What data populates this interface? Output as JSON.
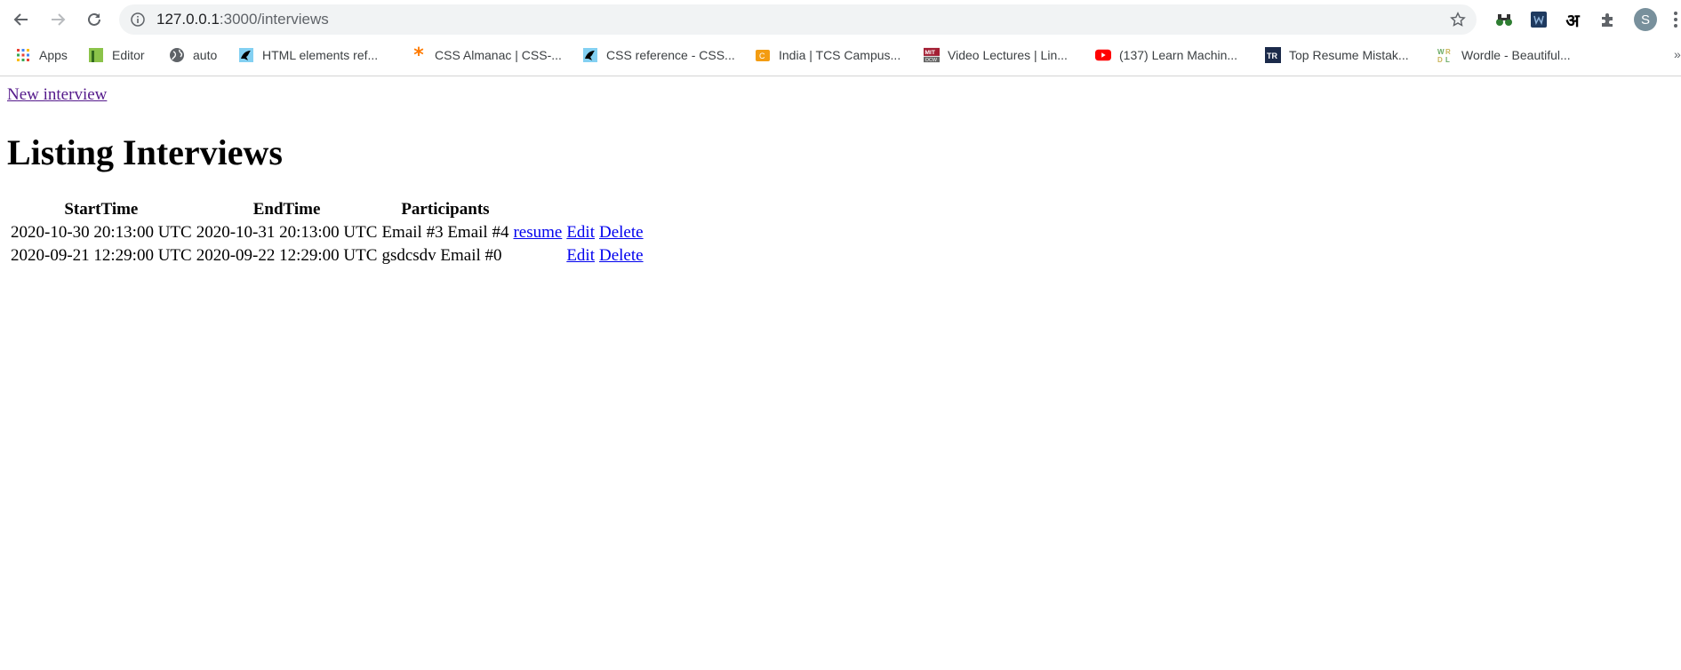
{
  "browser": {
    "url_host": "127.0.0.1",
    "url_path": ":3000/interviews",
    "avatar_letter": "S",
    "devanagari_ext": "अ",
    "bookmarks": [
      {
        "label": "Apps",
        "icon": "apps-grid-icon"
      },
      {
        "label": "Editor",
        "icon": "editor-icon"
      },
      {
        "label": "auto",
        "icon": "globe-icon"
      },
      {
        "label": "HTML elements ref...",
        "icon": "mdn-icon"
      },
      {
        "label": "CSS Almanac | CSS-...",
        "icon": "css-tricks-icon"
      },
      {
        "label": "CSS reference - CSS...",
        "icon": "mdn-icon"
      },
      {
        "label": "India | TCS Campus...",
        "icon": "tcs-icon"
      },
      {
        "label": "Video Lectures | Lin...",
        "icon": "mit-ocw-icon"
      },
      {
        "label": "(137) Learn Machin...",
        "icon": "youtube-icon"
      },
      {
        "label": "Top Resume Mistak...",
        "icon": "topresume-icon"
      },
      {
        "label": "Wordle - Beautiful...",
        "icon": "wordle-icon"
      }
    ],
    "more_label": "»"
  },
  "page": {
    "new_link": "New interview",
    "title": "Listing Interviews",
    "columns": [
      "StartTime",
      "EndTime",
      "Participants"
    ],
    "rows": [
      {
        "start": "2020-10-30 20:13:00 UTC",
        "end": "2020-10-31 20:13:00 UTC",
        "participants": "Email #3 Email #4",
        "resume": "resume",
        "edit": "Edit",
        "delete": "Delete"
      },
      {
        "start": "2020-09-21 12:29:00 UTC",
        "end": "2020-09-22 12:29:00 UTC",
        "participants": "gsdcsdv Email #0",
        "resume": "",
        "edit": "Edit",
        "delete": "Delete"
      }
    ]
  },
  "colors": {
    "link_visited": "#551a8b",
    "link": "#0000ee",
    "omnibox_bg": "#f1f3f4"
  }
}
